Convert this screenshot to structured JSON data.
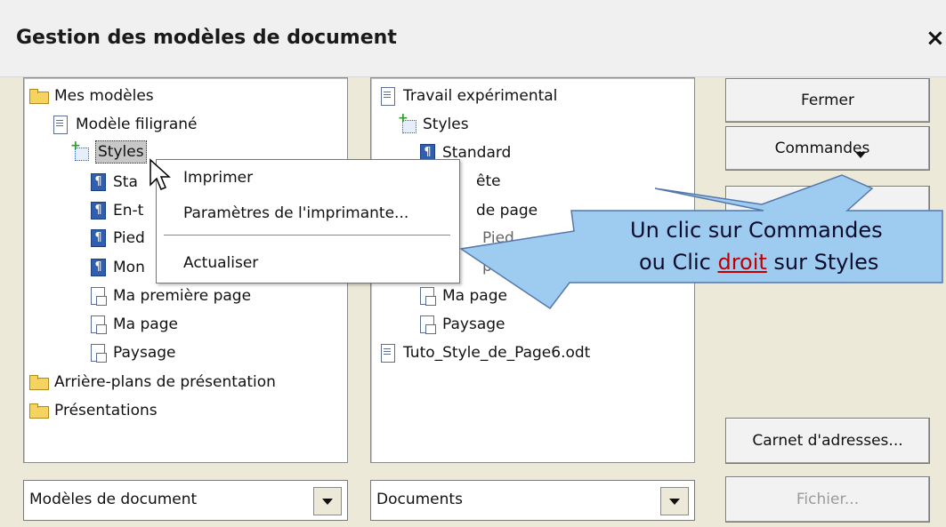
{
  "window": {
    "title": "Gestion des modèles de document",
    "close": "×"
  },
  "left_tree": {
    "items": [
      {
        "label": "Mes modèles",
        "icon": "folder-open-icon"
      },
      {
        "label": "Modèle filigrané",
        "icon": "document-icon"
      },
      {
        "label": "Styles",
        "icon": "styles-icon",
        "selected": true
      },
      {
        "label": "Standard",
        "icon": "paragraph-style-icon",
        "display": "Sta"
      },
      {
        "label": "En-tête",
        "icon": "paragraph-style-icon",
        "display": "En-t"
      },
      {
        "label": "Pied de page",
        "icon": "paragraph-style-icon",
        "display": "Pied"
      },
      {
        "label": "Mon",
        "icon": "paragraph-style-icon",
        "display": "Mon"
      },
      {
        "label": "Ma première page",
        "icon": "page-style-icon"
      },
      {
        "label": "Ma page",
        "icon": "page-style-icon"
      },
      {
        "label": "Paysage",
        "icon": "page-style-icon"
      },
      {
        "label": "Arrière-plans de présentation",
        "icon": "folder-icon"
      },
      {
        "label": "Présentations",
        "icon": "folder-icon"
      }
    ]
  },
  "right_tree": {
    "items": [
      {
        "label": "Travail expérimental",
        "icon": "document-icon"
      },
      {
        "label": "Styles",
        "icon": "styles-icon"
      },
      {
        "label": "Standard",
        "icon": "paragraph-style-icon"
      },
      {
        "label": "ête",
        "icon": "paragraph-style-icon"
      },
      {
        "label": "de page",
        "icon": "paragraph-style-icon"
      },
      {
        "label": "Pied",
        "icon": "paragraph-style-icon"
      },
      {
        "label": "première page",
        "icon": "page-style-icon"
      },
      {
        "label": "Ma page",
        "icon": "page-style-icon"
      },
      {
        "label": "Paysage",
        "icon": "page-style-icon"
      },
      {
        "label": "Tuto_Style_de_Page6.odt",
        "icon": "document-icon"
      }
    ]
  },
  "buttons": {
    "fermer": "Fermer",
    "commandes": "Commandes",
    "carnet": "Carnet d'adresses...",
    "fichier": "Fichier..."
  },
  "selects": {
    "left": "Modèles de document",
    "right": "Documents"
  },
  "context_menu": {
    "items": [
      "Imprimer",
      "Paramètres de l'imprimante...",
      "Actualiser"
    ]
  },
  "callout": {
    "line1": "Un clic sur Commandes",
    "line2_pre": "ou Clic ",
    "line2_word": "droit",
    "line2_post": " sur Styles",
    "fill_color": "#9ecbf0",
    "stroke_color": "#5577aa"
  }
}
